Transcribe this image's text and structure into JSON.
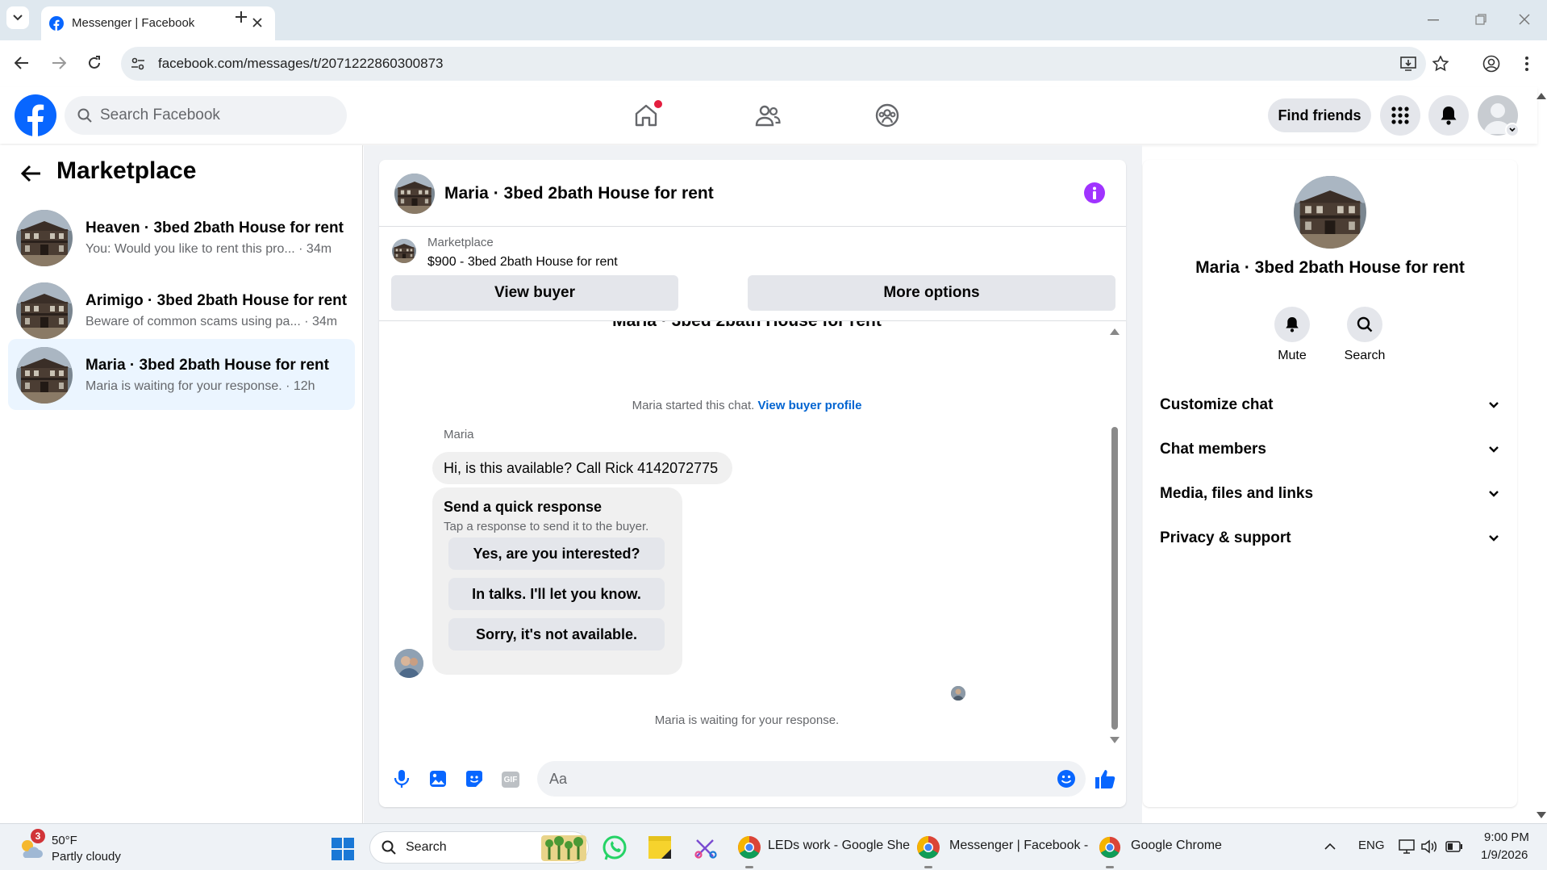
{
  "browser": {
    "tab_title": "Messenger | Facebook",
    "url": "facebook.com/messages/t/2071222860300873"
  },
  "header": {
    "search_placeholder": "Search Facebook",
    "find_friends": "Find friends"
  },
  "sidebar": {
    "title": "Marketplace",
    "conversations": [
      {
        "title": "Heaven · 3bed 2bath House for rent",
        "preview": "You: Would you like to rent this pro... · 34m",
        "active": false
      },
      {
        "title": "Arimigo · 3bed 2bath House for rent",
        "preview": "Beware of common scams using pa... · 34m",
        "active": false
      },
      {
        "title": "Maria · 3bed 2bath House for rent",
        "preview": "Maria is waiting for your response. · 12h",
        "active": true
      }
    ]
  },
  "chat": {
    "title": "Maria · 3bed 2bath House for rent",
    "listing_source": "Marketplace",
    "listing_line": "$900 - 3bed 2bath House for rent",
    "view_buyer": "View buyer",
    "more_options": "More options",
    "partial_header": "Maria · 3bed 2bath House for rent",
    "started_text": "Maria started this chat.",
    "view_buyer_profile": "View buyer profile",
    "sender_name": "Maria",
    "message": "Hi, is this available? Call Rick 4142072775",
    "quick_title": "Send a quick response",
    "quick_sub": "Tap a response to send it to the buyer.",
    "quick_responses": [
      "Yes, are you interested?",
      "In talks. I'll let you know.",
      "Sorry, it's not available."
    ],
    "waiting_text": "Maria is waiting for your response.",
    "composer_placeholder": "Aa"
  },
  "details": {
    "title": "Maria · 3bed 2bath House for rent",
    "mute": "Mute",
    "search": "Search",
    "sections": [
      "Customize chat",
      "Chat members",
      "Media, files and links",
      "Privacy & support"
    ]
  },
  "taskbar": {
    "weather_badge": "3",
    "temp": "50°F",
    "condition": "Partly cloudy",
    "search": "Search",
    "apps": [
      "LEDs work - Google She",
      "Messenger | Facebook -",
      "Google Chrome"
    ],
    "lang": "ENG",
    "time": "9:00 PM",
    "date": "1/9/2026"
  },
  "colors": {
    "fb_blue": "#0866ff",
    "messenger_purple": "#a033ff",
    "link_blue": "#0064d1"
  }
}
